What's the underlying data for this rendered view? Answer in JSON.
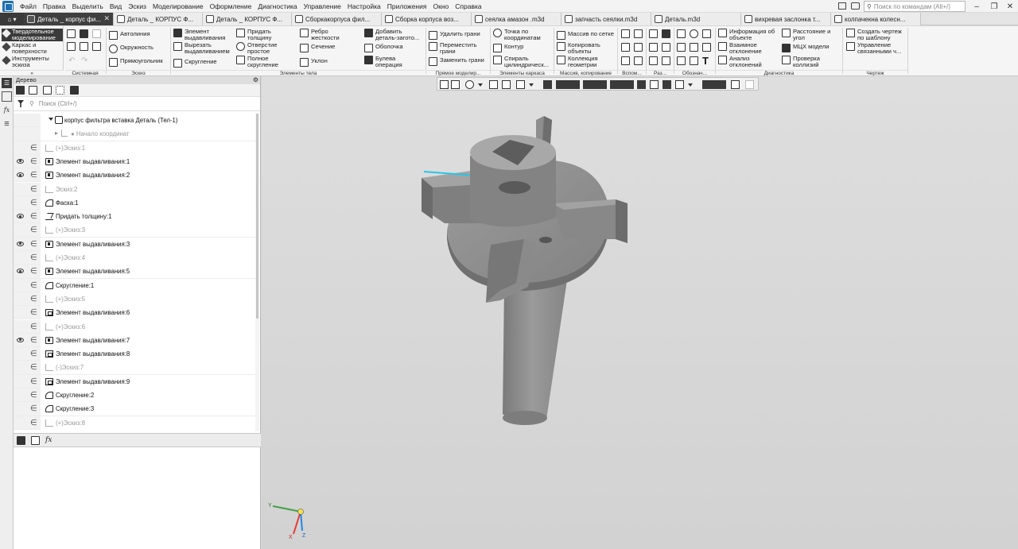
{
  "menubar": {
    "items": [
      "Файл",
      "Правка",
      "Выделить",
      "Вид",
      "Эскиз",
      "Моделирование",
      "Оформление",
      "Диагностика",
      "Управление",
      "Настройка",
      "Приложения",
      "Окно",
      "Справка"
    ],
    "search_placeholder": "Поиск по командам (Alt+/)"
  },
  "tabs": [
    {
      "label": "Деталь _ корпус фи...",
      "active": true
    },
    {
      "label": "Деталь _ КОРПУС Ф..."
    },
    {
      "label": "Деталь _ КОРПУС Ф..."
    },
    {
      "label": "Сборкакорпуса фил..."
    },
    {
      "label": "Сборка корпуса воз..."
    },
    {
      "label": "сеялка амазон .m3d"
    },
    {
      "label": "запчасть сеялки.m3d"
    },
    {
      "label": "Деталь.m3d"
    },
    {
      "label": "вихревая заслонка т..."
    },
    {
      "label": "колпачекна колесн..."
    }
  ],
  "ribbon": {
    "modes": [
      "Твердотельное моделирование",
      "Каркас и поверхности",
      "Инструменты эскиза"
    ],
    "sketch": {
      "line": "Автолиния",
      "circle": "Окружность",
      "rect": "Прямоугольник"
    },
    "body": {
      "extrude": "Элемент выдавливания",
      "cut_extrude": "Вырезать выдавливанием",
      "fillet": "Скругление",
      "thicken": "Придать толщину",
      "hole": "Отверстие простое",
      "full_fillet": "Полное скругление",
      "rib": "Ребро жесткости",
      "section": "Сечение",
      "draft": "Уклон",
      "add_blank": "Добавить деталь-загото...",
      "shell": "Оболочка",
      "boolean": "Булева операция"
    },
    "direct": {
      "delete_faces": "Удалить грани",
      "move_faces": "Переместить грани",
      "replace_faces": "Заменить грани"
    },
    "frame": {
      "point": "Точка по координатам",
      "contour": "Контур",
      "spiral": "Спираль цилиндрическ..."
    },
    "pattern": {
      "grid": "Массив по сетке",
      "copy": "Копировать объекты",
      "collection": "Коллекция геометрии"
    },
    "diag": {
      "info": "Информация об объекте",
      "mutual": "Взаимное отклонение",
      "analysis": "Анализ отклонений",
      "distance": "Расстояние и угол",
      "mcx": "МЦХ модели",
      "collision": "Проверка коллизий"
    },
    "drawing": {
      "create": "Создать чертеж по шаблону",
      "manage": "Управление связанными ч..."
    },
    "groups": {
      "system": "Системная",
      "sketch": "Эскиз",
      "body": "Элементы тела",
      "direct": "Прямое моделир...",
      "frame": "Элементы каркаса",
      "pattern": "Массив, копирование",
      "aux": "Вспом...",
      "size": "Раз...",
      "notation": "Обознач...",
      "diag": "Диагностика",
      "drawing": "Чертеж"
    }
  },
  "tree": {
    "title": "Дерево",
    "search_placeholder": "Поиск (Ctrl+/)",
    "root": "корпус фильтра вставка Деталь (Тел-1)",
    "origin": "Начало координат",
    "rows": [
      {
        "label": "(+)Эскиз:1",
        "eye": false,
        "dim": true,
        "icon": "sk"
      },
      {
        "label": "Элемент выдавливания:1",
        "eye": true,
        "icon": "ext"
      },
      {
        "label": "Элемент выдавливания:2",
        "eye": true,
        "icon": "ext"
      },
      {
        "label": "Эскиз:2",
        "eye": false,
        "dim": true,
        "icon": "sk"
      },
      {
        "label": "Фаска:1",
        "eye": false,
        "icon": "fil"
      },
      {
        "label": "Придать толщину:1",
        "eye": true,
        "icon": "th"
      },
      {
        "label": "(+)Эскиз:3",
        "eye": false,
        "dim": true,
        "icon": "sk"
      },
      {
        "label": "Элемент выдавливания:3",
        "eye": true,
        "icon": "ext"
      },
      {
        "label": "(+)Эскиз:4",
        "eye": false,
        "dim": true,
        "icon": "sk"
      },
      {
        "label": "Элемент выдавливания:5",
        "eye": true,
        "icon": "ext"
      },
      {
        "label": "Скругление:1",
        "eye": false,
        "icon": "fil"
      },
      {
        "label": "(+)Эскиз:5",
        "eye": false,
        "dim": true,
        "icon": "sk"
      },
      {
        "label": "Элемент выдавливания:6",
        "eye": false,
        "icon": "cut"
      },
      {
        "label": "(+)Эскиз:6",
        "eye": false,
        "dim": true,
        "icon": "sk"
      },
      {
        "label": "Элемент выдавливания:7",
        "eye": true,
        "icon": "ext"
      },
      {
        "label": "Элемент выдавливания:8",
        "eye": false,
        "icon": "cut"
      },
      {
        "label": "(-)Эскиз:7",
        "eye": false,
        "dim": true,
        "icon": "sk"
      },
      {
        "label": "Элемент выдавливания:9",
        "eye": false,
        "icon": "cut"
      },
      {
        "label": "Скругление:2",
        "eye": false,
        "icon": "fil"
      },
      {
        "label": "Скругление:3",
        "eye": false,
        "icon": "fil"
      },
      {
        "label": "(+)Эскиз:8",
        "eye": false,
        "dim": true,
        "icon": "sk"
      }
    ]
  },
  "triad": {
    "x": "X",
    "y": "Y",
    "z": "Z"
  },
  "colors": {
    "x_axis": "#e53935",
    "y_axis": "#43a047",
    "z_axis": "#1e88e5",
    "model": "#8c8c8c",
    "highlight": "#29c5e6"
  }
}
